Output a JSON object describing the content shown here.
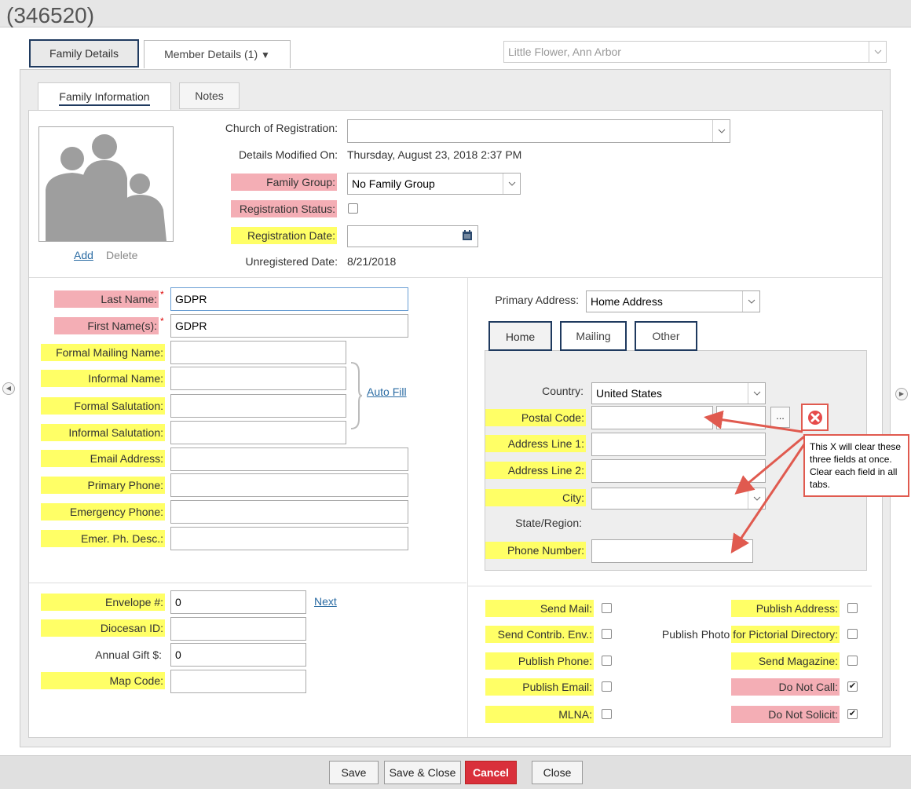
{
  "window_title": "(346520)",
  "top_tabs": {
    "family_details": "Family Details",
    "member_details": "Member Details (1)",
    "member_caret": "▼"
  },
  "parish_select": "Little Flower, Ann Arbor",
  "inner_tabs": {
    "family_information": "Family Information",
    "notes": "Notes"
  },
  "photo": {
    "add": "Add",
    "delete": "Delete"
  },
  "header_fields": {
    "church_label": "Church of Registration:",
    "church_value": "",
    "modified_label": "Details Modified On:",
    "modified_value": "Thursday, August 23, 2018 2:37 PM",
    "family_group_label": "Family Group:",
    "family_group_value": "No Family Group",
    "reg_status_label": "Registration Status:",
    "reg_date_label": "Registration Date:",
    "unreg_label": "Unregistered Date:",
    "unreg_value": "8/21/2018"
  },
  "name_fields": {
    "last_name_label": "Last Name:",
    "last_name_value": "GDPR",
    "first_name_label": "First Name(s):",
    "first_name_value": "GDPR",
    "formal_mailing_label": "Formal Mailing Name:",
    "informal_name_label": "Informal Name:",
    "formal_salutation_label": "Formal Salutation:",
    "informal_salutation_label": "Informal Salutation:",
    "auto_fill": "Auto Fill",
    "email_label": "Email Address:",
    "primary_phone_label": "Primary Phone:",
    "emergency_phone_label": "Emergency Phone:",
    "emer_desc_label": "Emer. Ph. Desc.:"
  },
  "address": {
    "primary_label": "Primary Address:",
    "primary_value": "Home Address",
    "tabs": [
      "Home",
      "Mailing",
      "Other"
    ],
    "country_label": "Country:",
    "country_value": "United States",
    "postal_label": "Postal Code:",
    "lookup": "...",
    "line1_label": "Address Line 1:",
    "line2_label": "Address Line 2:",
    "city_label": "City:",
    "state_label": "State/Region:",
    "phone_label": "Phone Number:"
  },
  "annotation": "This X will clear these three fields at once. Clear each field in all tabs.",
  "lower_left": {
    "envelope_label": "Envelope #:",
    "envelope_value": "0",
    "next": "Next",
    "diocesan_label": "Diocesan ID:",
    "annual_gift_label": "Annual Gift $:",
    "annual_gift_value": "0",
    "map_code_label": "Map Code:"
  },
  "checks_left": [
    "Send Mail:",
    "Send Contrib. Env.:",
    "Publish Phone:",
    "Publish Email:",
    "MLNA:"
  ],
  "checks_right": [
    "Publish Address:",
    "Publish Photo for Pictorial Directory:",
    "Send Magazine:",
    "Do Not Call:",
    "Do Not Solicit:"
  ],
  "checks_right_checked": [
    "",
    "",
    "",
    "✔",
    "✔"
  ],
  "buttons": {
    "save": "Save",
    "save_close": "Save & Close",
    "cancel": "Cancel",
    "close": "Close"
  },
  "colors": {
    "highlight_yellow": "#ffff66",
    "highlight_pink": "#f4aeb5",
    "cancel_red": "#d9303b",
    "annotation_red": "#e05a4f",
    "tab_border": "#1f3a5f"
  }
}
